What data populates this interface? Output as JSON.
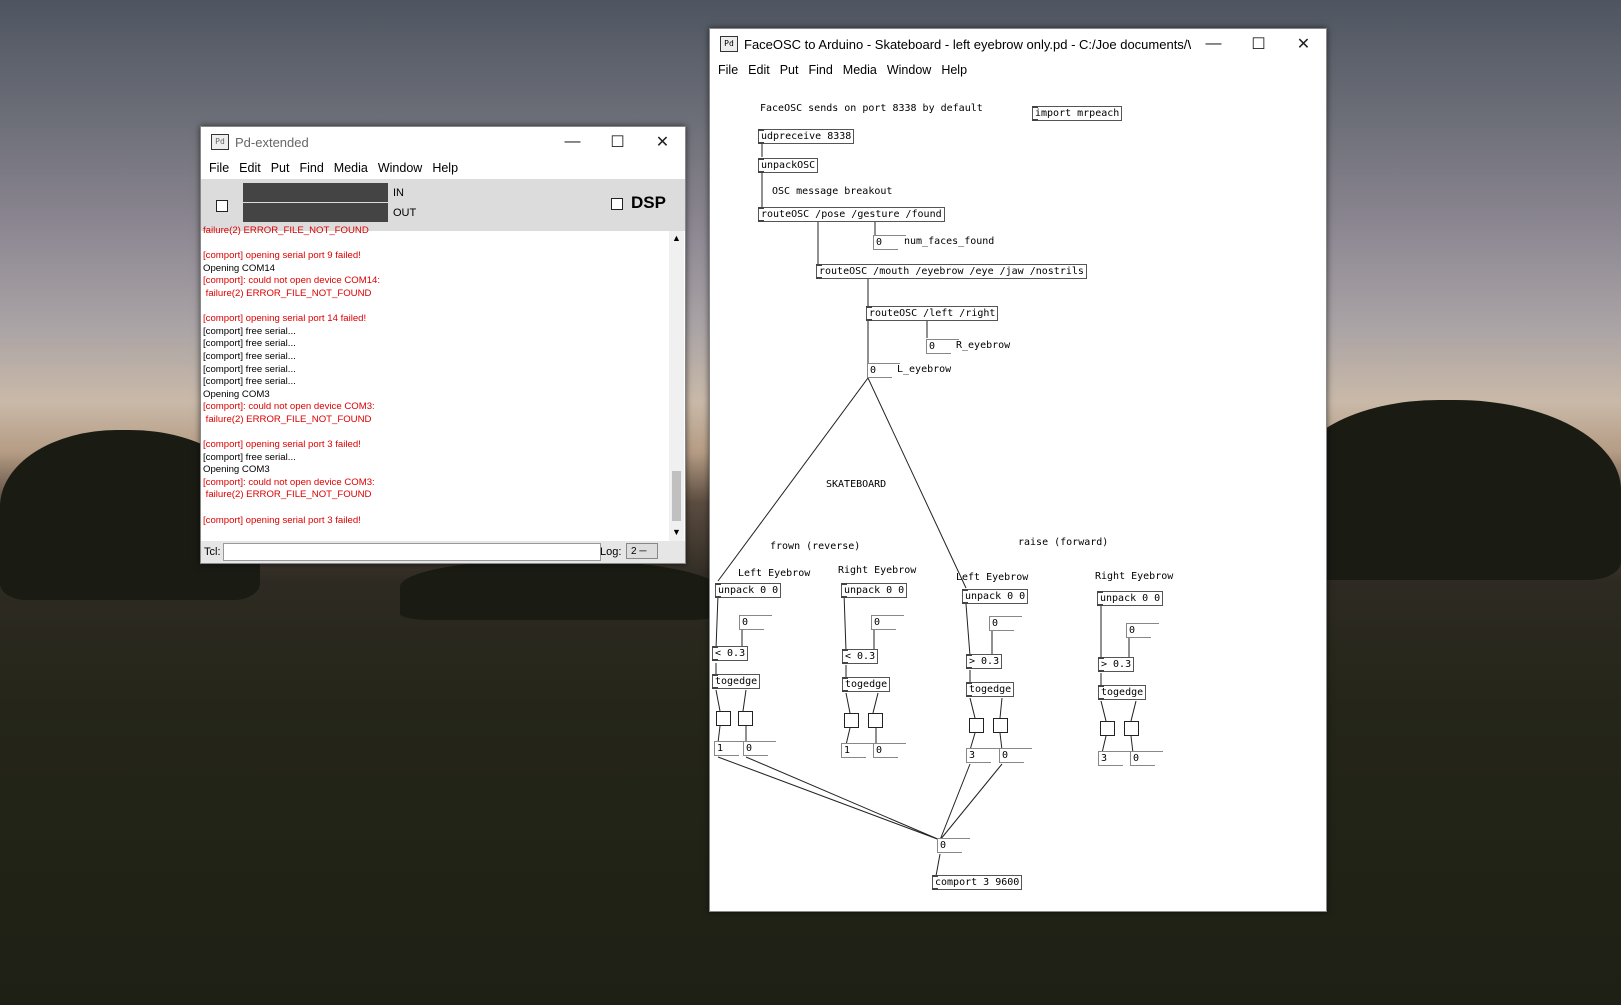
{
  "pd_console": {
    "title": "Pd-extended",
    "menu": [
      "File",
      "Edit",
      "Put",
      "Find",
      "Media",
      "Window",
      "Help"
    ],
    "meter_in_label": "IN",
    "meter_out_label": "OUT",
    "dsp_label": "DSP",
    "log_lines": [
      {
        "text": "failure(2) ERROR_FILE_NOT_FOUND",
        "error": true
      },
      {
        "text": "",
        "error": false
      },
      {
        "text": "[comport] opening serial port 9 failed!",
        "error": true
      },
      {
        "text": "Opening COM14",
        "error": false
      },
      {
        "text": "[comport]: could not open device COM14:",
        "error": true
      },
      {
        "text": " failure(2) ERROR_FILE_NOT_FOUND",
        "error": true
      },
      {
        "text": "",
        "error": false
      },
      {
        "text": "[comport] opening serial port 14 failed!",
        "error": true
      },
      {
        "text": "[comport] free serial...",
        "error": false
      },
      {
        "text": "[comport] free serial...",
        "error": false
      },
      {
        "text": "[comport] free serial...",
        "error": false
      },
      {
        "text": "[comport] free serial...",
        "error": false
      },
      {
        "text": "[comport] free serial...",
        "error": false
      },
      {
        "text": "Opening COM3",
        "error": false
      },
      {
        "text": "[comport]: could not open device COM3:",
        "error": true
      },
      {
        "text": " failure(2) ERROR_FILE_NOT_FOUND",
        "error": true
      },
      {
        "text": "",
        "error": false
      },
      {
        "text": "[comport] opening serial port 3 failed!",
        "error": true
      },
      {
        "text": "[comport] free serial...",
        "error": false
      },
      {
        "text": "Opening COM3",
        "error": false
      },
      {
        "text": "[comport]: could not open device COM3:",
        "error": true
      },
      {
        "text": " failure(2) ERROR_FILE_NOT_FOUND",
        "error": true
      },
      {
        "text": "",
        "error": false
      },
      {
        "text": "[comport] opening serial port 3 failed!",
        "error": true
      }
    ],
    "tcl_label": "Tcl:",
    "tcl_value": "",
    "log_label": "Log:",
    "log_level": "2"
  },
  "patch": {
    "title": "FaceOSC to Arduino - Skateboard - left eyebrow only.pd  - C:/Joe documents/WORK/u...",
    "menu": [
      "File",
      "Edit",
      "Put",
      "Find",
      "Media",
      "Window",
      "Help"
    ],
    "comments": {
      "faceosc": "FaceOSC sends on port 8338 by default",
      "osc_breakout": "OSC message breakout",
      "num_faces": "num_faces_found",
      "r_eyebrow": "R_eyebrow",
      "l_eyebrow": "L_eyebrow",
      "skateboard": "SKATEBOARD",
      "frown": "frown (reverse)",
      "raise": "raise (forward)",
      "left_eyebrow_1": "Left Eyebrow",
      "right_eyebrow_1": "Right Eyebrow",
      "left_eyebrow_2": "Left Eyebrow",
      "right_eyebrow_2": "Right Eyebrow"
    },
    "objects": {
      "import": "import mrpeach",
      "udpreceive": "udpreceive 8338",
      "unpackosc": "unpackOSC",
      "route1": "routeOSC /pose /gesture /found",
      "route2": "routeOSC /mouth /eyebrow /eye /jaw /nostrils",
      "route3": "routeOSC /left /right",
      "unpack_a": "unpack 0 0",
      "unpack_b": "unpack 0 0",
      "unpack_c": "unpack 0 0",
      "unpack_d": "unpack 0 0",
      "cmp_a": "< 0.3",
      "cmp_b": "< 0.3",
      "cmp_c": "> 0.3",
      "cmp_d": "> 0.3",
      "togedge_a": "togedge",
      "togedge_b": "togedge",
      "togedge_c": "togedge",
      "togedge_d": "togedge",
      "comport": "comport 3 9600"
    },
    "numbers": {
      "num_faces": "0",
      "r_eyebrow": "0",
      "l_eyebrow": "0",
      "a_mid": "0",
      "b_mid": "0",
      "c_mid": "0",
      "d_mid": "0",
      "a_out1": "1",
      "a_out2": "0",
      "b_out1": "1",
      "b_out2": "0",
      "c_out1": "3",
      "c_out2": "0",
      "d_out1": "3",
      "d_out2": "0",
      "final": "0"
    }
  }
}
